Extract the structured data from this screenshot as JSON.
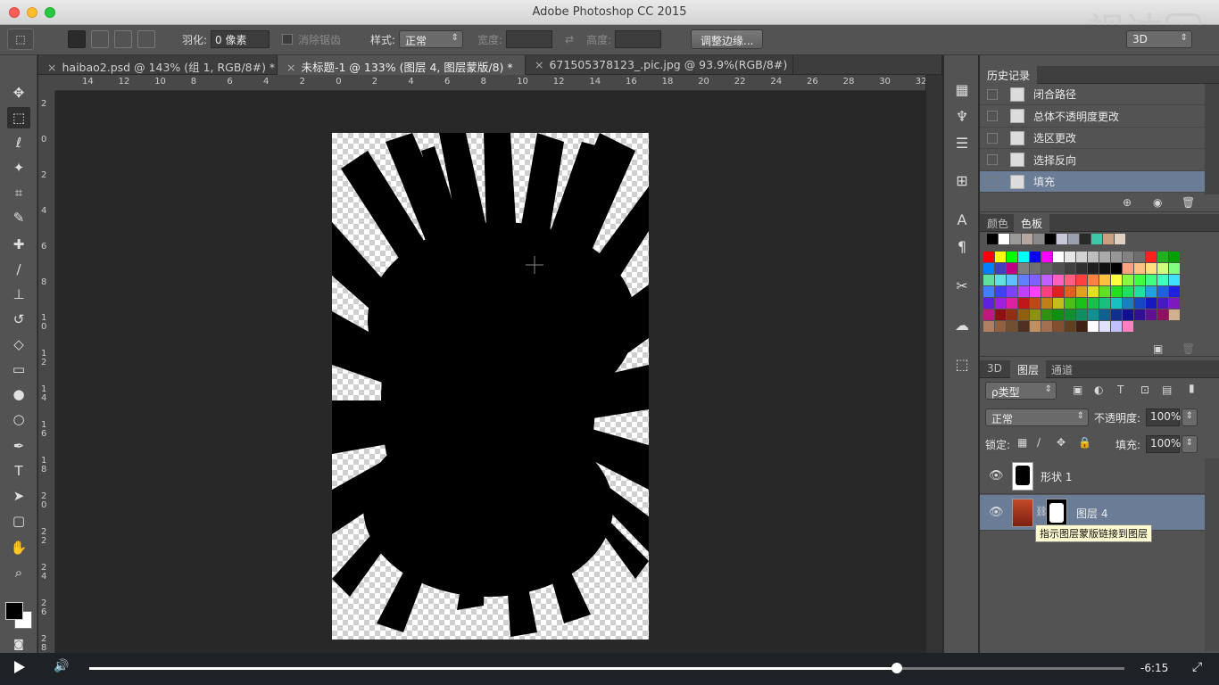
{
  "window": {
    "title": "Adobe Photoshop CC 2015"
  },
  "watermark": {
    "text": "视达"
  },
  "options_bar": {
    "feather_label": "羽化:",
    "feather_value": "0 像素",
    "antialias_label": "消除锯齿",
    "style_label": "样式:",
    "style_value": "正常",
    "width_label": "宽度:",
    "height_label": "高度:",
    "refine_button": "调整边缘...",
    "workspace_value": "3D"
  },
  "tabs": [
    {
      "label": "haibao2.psd @ 143% (组 1, RGB/8#) *"
    },
    {
      "label": "未标题-1 @ 133% (图层 4, 图层蒙版/8) *"
    },
    {
      "label": "671505378123_.pic.jpg @ 93.9%(RGB/8#)"
    }
  ],
  "ruler_h": [
    "14",
    "12",
    "10",
    "8",
    "6",
    "4",
    "2",
    "0",
    "2",
    "4",
    "6",
    "8",
    "10",
    "12",
    "14",
    "16",
    "18",
    "20",
    "22",
    "24",
    "26",
    "28",
    "30",
    "32"
  ],
  "ruler_v": [
    "2",
    "0",
    "2",
    "4",
    "6",
    "8",
    "1 0",
    "1 2",
    "1 4",
    "1 6",
    "1 8",
    "2 0",
    "2 2",
    "2 4",
    "2 6",
    "2 8"
  ],
  "history": {
    "tab_label": "历史记录",
    "items": [
      {
        "label": "闭合路径",
        "selected": false
      },
      {
        "label": "总体不透明度更改",
        "selected": false
      },
      {
        "label": "选区更改",
        "selected": false
      },
      {
        "label": "选择反向",
        "selected": false
      },
      {
        "label": "填充",
        "selected": true
      }
    ]
  },
  "swatches_panel": {
    "tabs": [
      "颜色",
      "色板"
    ],
    "recent": [
      "#000000",
      "#ffffff",
      "#9a9a9a",
      "#b5a8a0",
      "#8a8a8a",
      "#000000",
      "#c8c8d8",
      "#9aa0b0",
      "#2a2a2a",
      "#3fc8a8",
      "#c8a080",
      "#e0d0c0"
    ],
    "rows": [
      [
        "#ff0000",
        "#ffff00",
        "#00ff00",
        "#00ffff",
        "#0000ff",
        "#ff00ff",
        "#ffffff",
        "#e6e6e6",
        "#d2d2d2",
        "#bebebe",
        "#aaaaaa",
        "#969696",
        "#828282",
        "#6e6e6e",
        "#ff2020",
        "#20b020",
        "#00a000"
      ],
      [
        "#0080ff",
        "#4040c0",
        "#c00080",
        "#808080",
        "#707070",
        "#606060",
        "#505050",
        "#404040",
        "#303030",
        "#202020",
        "#101010",
        "#000000",
        "#ffa080",
        "#ffc080",
        "#ffe080",
        "#d0ff80",
        "#80ff80"
      ],
      [
        "#60e0a0",
        "#60e0e0",
        "#60c0ff",
        "#6080ff",
        "#8060ff",
        "#c060ff",
        "#ff60c0",
        "#ff6080",
        "#ff4040",
        "#ff8040",
        "#ffc040",
        "#ffff40",
        "#80ff40",
        "#40ff40",
        "#40ff80",
        "#40ffc0",
        "#40e0ff"
      ],
      [
        "#4080ff",
        "#4040ff",
        "#8040ff",
        "#c040ff",
        "#ff40ff",
        "#ff4080",
        "#e02020",
        "#e06020",
        "#e0a020",
        "#e0e020",
        "#60e020",
        "#20e020",
        "#20e060",
        "#20e0a0",
        "#20a0e0",
        "#2060e0",
        "#2020e0"
      ],
      [
        "#6020e0",
        "#a020e0",
        "#e020a0",
        "#c01818",
        "#c04818",
        "#c08018",
        "#c0c018",
        "#48c018",
        "#18c018",
        "#18c048",
        "#18c080",
        "#18c0c0",
        "#1880c0",
        "#1848c0",
        "#1818c0",
        "#4818c0",
        "#8018c0"
      ],
      [
        "#c01880",
        "#901010",
        "#903010",
        "#906010",
        "#909010",
        "#309010",
        "#109010",
        "#109030",
        "#109060",
        "#109090",
        "#106090",
        "#103090",
        "#101090",
        "#301090",
        "#601090",
        "#901060",
        "#d0b090"
      ],
      [
        "#b08060",
        "#906040",
        "#705030",
        "#503020",
        "#c09060",
        "#a07050",
        "#805030",
        "#604020",
        "#402010",
        "#ffffff",
        "#e0e0ff",
        "#c0c0ff",
        "#ff80c0"
      ]
    ]
  },
  "layers_panel": {
    "tabs": [
      "3D",
      "图层",
      "通道"
    ],
    "filter_label": "ρ类型",
    "blend_mode": "正常",
    "opacity_label": "不透明度:",
    "opacity_value": "100%",
    "lock_label": "锁定:",
    "fill_label": "填充:",
    "fill_value": "100%",
    "layers": [
      {
        "name": "形状 1",
        "selected": false
      },
      {
        "name": "图层 4",
        "selected": true
      }
    ],
    "tooltip": "指示图层蒙版链接到图层"
  },
  "video": {
    "time": "-6:15",
    "progress": 0.78
  }
}
